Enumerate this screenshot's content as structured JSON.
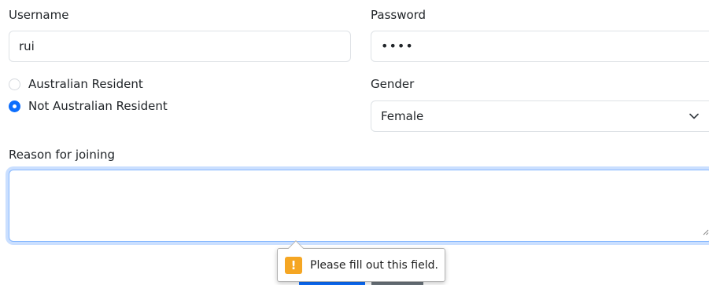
{
  "form": {
    "username": {
      "label": "Username",
      "value": "rui"
    },
    "password": {
      "label": "Password",
      "value": "••••"
    },
    "residency": {
      "options": [
        {
          "label": "Australian Resident",
          "checked": false
        },
        {
          "label": "Not Australian Resident",
          "checked": true
        }
      ]
    },
    "gender": {
      "label": "Gender",
      "selected": "Female"
    },
    "reason": {
      "label": "Reason for joining",
      "value": ""
    }
  },
  "validation": {
    "message": "Please fill out this field.",
    "icon": "warning-icon",
    "icon_glyph": "!",
    "icon_color": "#f5a623"
  },
  "colors": {
    "accent": "#0d6efd",
    "focus_border": "#86b7fe",
    "secondary_button": "#6c757d"
  }
}
